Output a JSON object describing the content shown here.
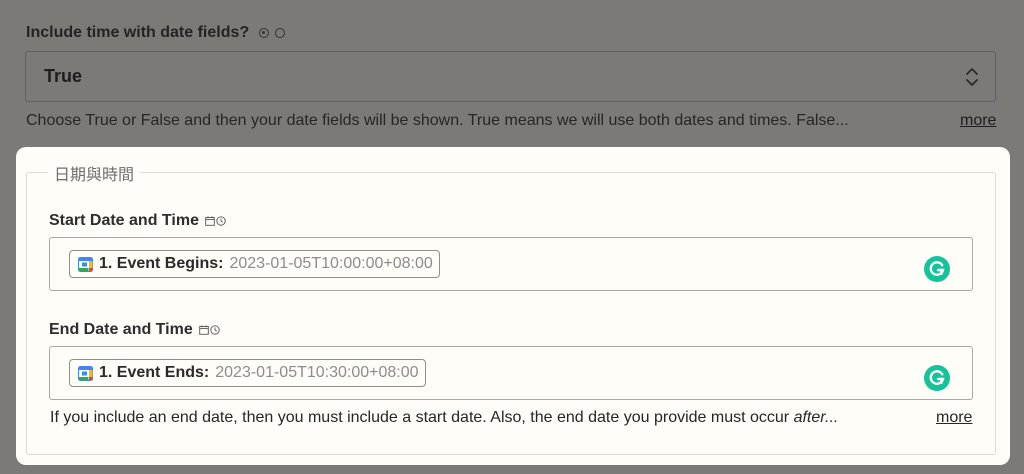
{
  "include_time": {
    "label": "Include time with date fields?",
    "options": [
      "on",
      "off"
    ],
    "selected_value": "True",
    "hint": "Choose True or False and then your date fields will be shown. True means we will use both dates and times. False...",
    "more_label": "more"
  },
  "section": {
    "legend": "日期與時間",
    "start": {
      "label": "Start Date and Time",
      "pill_label": "1. Event Begins:",
      "pill_value": "2023-01-05T10:00:00+08:00"
    },
    "end": {
      "label": "End Date and Time",
      "pill_label": "1. Event Ends:",
      "pill_value": "2023-01-05T10:30:00+08:00"
    },
    "hint_prefix": "If you include an end date, then you must include a start date. Also, the end date you provide must occur ",
    "hint_emphasis": "after...",
    "more_label": "more"
  },
  "colors": {
    "grammarly": "#15c39a",
    "card_bg": "#fffdf8",
    "overlay_bg": "#7b7a77"
  },
  "icons": [
    "calendar-icon",
    "clock-icon",
    "google-calendar-icon",
    "grammarly-icon",
    "chevron-updown-icon"
  ]
}
